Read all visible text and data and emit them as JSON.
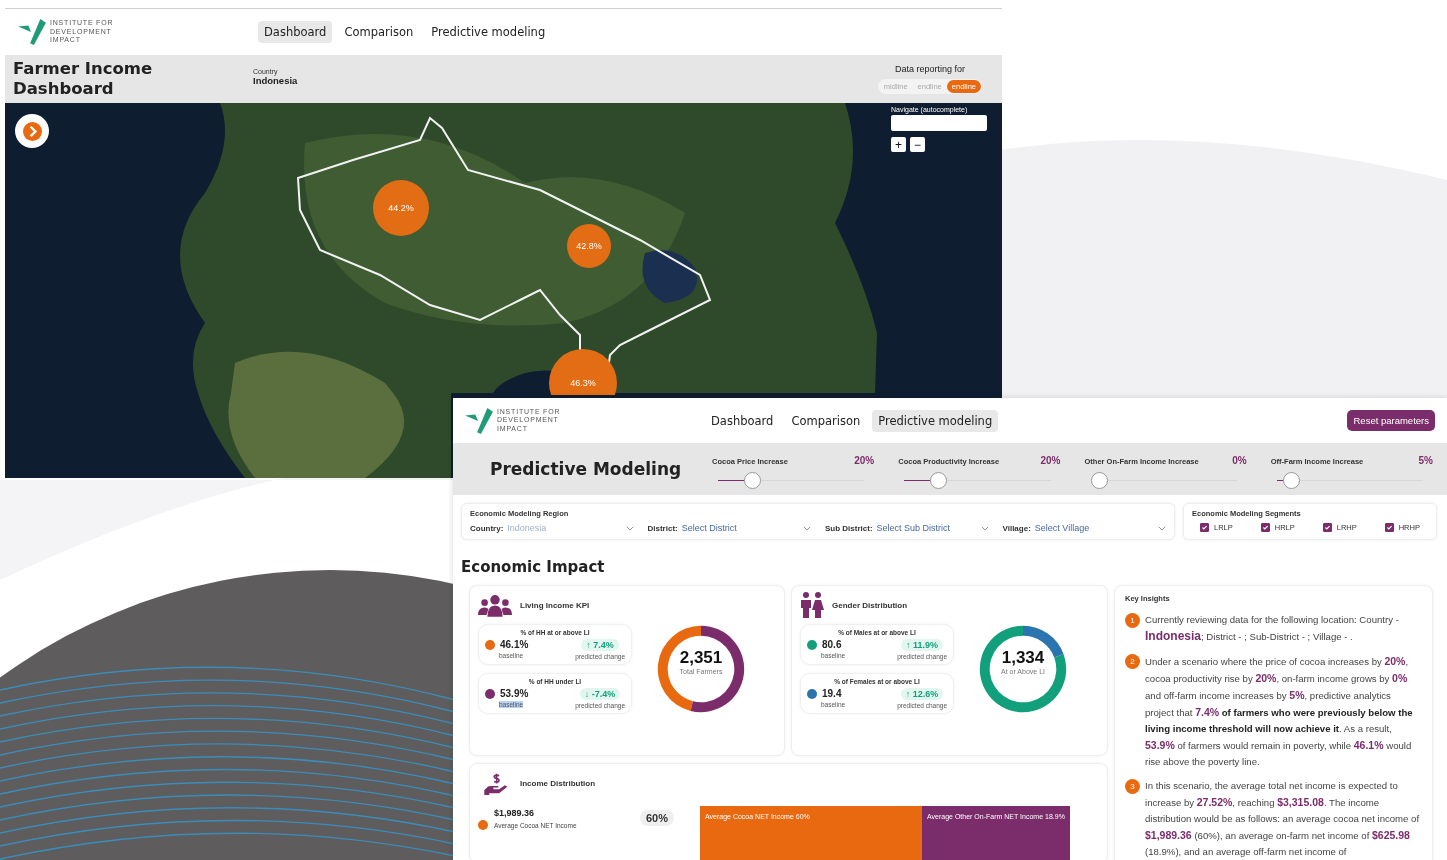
{
  "dashboard_window": {
    "brand": {
      "lines": [
        "INSTITUTE FOR",
        "DEVELOPMENT",
        "IMPACT"
      ]
    },
    "nav": [
      {
        "label": "Dashboard",
        "selected": true
      },
      {
        "label": "Comparison",
        "selected": false
      },
      {
        "label": "Predictive modeling",
        "selected": false
      }
    ],
    "title": "Farmer Income Dashboard",
    "country": {
      "label": "Country",
      "value": "Indonesia"
    },
    "reporting": {
      "label": "Data reporting for",
      "options": [
        {
          "label": "midline",
          "selected": false
        },
        {
          "label": "endline",
          "selected": false
        },
        {
          "label": "endline",
          "selected": true
        }
      ]
    },
    "navigate": {
      "label": "Navigate (autocomplete)"
    },
    "zoom_controls": [
      "+",
      "−"
    ],
    "map_markers": [
      {
        "label": "44.2%"
      },
      {
        "label": "42.8%"
      },
      {
        "label": "46.3%"
      }
    ]
  },
  "modeling_window": {
    "brand": {
      "lines": [
        "INSTITUTE FOR",
        "DEVELOPMENT",
        "IMPACT"
      ]
    },
    "nav": [
      {
        "label": "Dashboard",
        "selected": false
      },
      {
        "label": "Comparison",
        "selected": false
      },
      {
        "label": "Predictive modeling",
        "selected": true
      }
    ],
    "reset_button": "Reset parameters",
    "title": "Predictive Modeling",
    "sliders": [
      {
        "label": "Cocoa Price Increase",
        "reading": "20%",
        "level": 0.2
      },
      {
        "label": "Cocoa Productivity Increase",
        "reading": "20%",
        "level": 0.2
      },
      {
        "label": "Other On-Farm Income Increase",
        "reading": "0%",
        "level": 0
      },
      {
        "label": "Off-Farm Income Increase",
        "reading": "5%",
        "level": 0.05
      }
    ],
    "region": {
      "title": "Economic Modeling Region",
      "filters": [
        {
          "label": "Country:",
          "value": "Indonesia",
          "disabled": true
        },
        {
          "label": "District:",
          "value": "Select District",
          "disabled": false
        },
        {
          "label": "Sub District:",
          "value": "Select Sub District",
          "disabled": false
        },
        {
          "label": "Village:",
          "value": "Select Village",
          "disabled": false
        }
      ]
    },
    "segments": {
      "title": "Economic Modeling Segments",
      "items": [
        {
          "label": "LRLP",
          "checked": true
        },
        {
          "label": "HRLP",
          "checked": true
        },
        {
          "label": "LRHP",
          "checked": true
        },
        {
          "label": "HRHP",
          "checked": true
        }
      ]
    },
    "section_title": "Economic Impact",
    "living_income": {
      "title": "Living Income KPI",
      "metrics": [
        {
          "heading": "% of HH at or above LI",
          "value": "46.1%",
          "color": "#e8690f",
          "caption": "baseline",
          "highlighted": false,
          "change": "↑ 7.4%",
          "change_caption": "predicted change"
        },
        {
          "heading": "% of HH under LI",
          "value": "53.9%",
          "color": "#7b2d6b",
          "caption": "baseline",
          "highlighted": true,
          "change": "↓ -7.4%",
          "change_caption": "predicted change"
        }
      ],
      "total": "2,351",
      "total_caption": "Total Farmers",
      "chart_data": {
        "type": "donut",
        "values": [
          46.1,
          53.9
        ]
      }
    },
    "gender": {
      "title": "Gender Distribution",
      "metrics": [
        {
          "heading": "% of Males at or above LI",
          "value": "80.6",
          "color": "#12a07c",
          "caption": "baseline",
          "highlighted": false,
          "change": "↑ 11.9%",
          "change_caption": "predicted change"
        },
        {
          "heading": "% of Females at or above LI",
          "value": "19.4",
          "color": "#2a74b0",
          "caption": "baseline",
          "highlighted": false,
          "change": "↑ 12.6%",
          "change_caption": "predicted change"
        }
      ],
      "total": "1,334",
      "total_caption": "At or Above LI",
      "chart_data": {
        "type": "donut",
        "values": [
          80.6,
          19.4
        ]
      }
    },
    "income_distribution": {
      "title": "Income Distribution",
      "rows": [
        {
          "value": "$1,989.36",
          "caption": "Average Cocoa NET Income",
          "share": "60%",
          "color": "#e8690f"
        }
      ],
      "bar_segments": [
        {
          "label": "Average Cocoa NET Income 60%",
          "color": "#e8690f"
        },
        {
          "label": "Average Other On-Farm NET Income 18.9%",
          "color": "#7b2d6b"
        }
      ]
    },
    "key_insights": {
      "title": "Key Insights",
      "items": [
        {
          "number": "1",
          "runs": [
            {
              "kind": "plain",
              "text": "Currently reviewing data for the following location: Country - "
            },
            {
              "kind": "big",
              "text": "Indonesia"
            },
            {
              "kind": "plain",
              "text": "; District - ; Sub-District - ; Village - ."
            }
          ]
        },
        {
          "number": "2",
          "runs": [
            {
              "kind": "plain",
              "text": "Under a scenario where the price of cocoa increases by "
            },
            {
              "kind": "highlight",
              "text": "20%"
            },
            {
              "kind": "plain",
              "text": ", cocoa productivity rise by "
            },
            {
              "kind": "highlight",
              "text": "20%"
            },
            {
              "kind": "plain",
              "text": ", on-farm income grows by "
            },
            {
              "kind": "highlight",
              "text": "0%"
            },
            {
              "kind": "plain",
              "text": " and off-farm income increases by "
            },
            {
              "kind": "highlight",
              "text": "5%"
            },
            {
              "kind": "plain",
              "text": ", predictive analytics project that "
            },
            {
              "kind": "highlight",
              "text": "7.4%"
            },
            {
              "kind": "bold",
              "text": " of farmers who were previously below the living income threshold will now achieve it"
            },
            {
              "kind": "plain",
              "text": ". As a result, "
            },
            {
              "kind": "highlight",
              "text": "53.9%"
            },
            {
              "kind": "plain",
              "text": " of farmers would remain in poverty, while "
            },
            {
              "kind": "highlight",
              "text": "46.1%"
            },
            {
              "kind": "plain",
              "text": " would rise above the poverty line."
            }
          ]
        },
        {
          "number": "3",
          "runs": [
            {
              "kind": "plain",
              "text": "In this scenario, the average total net income is expected to increase by "
            },
            {
              "kind": "highlight",
              "text": "27.52%"
            },
            {
              "kind": "plain",
              "text": ", reaching "
            },
            {
              "kind": "highlight",
              "text": "$3,315.08"
            },
            {
              "kind": "plain",
              "text": ". The income distribution would be as follows: an average cocoa net income of "
            },
            {
              "kind": "highlight",
              "text": "$1,989.36"
            },
            {
              "kind": "plain",
              "text": " (60%), an average on-farm net income of "
            },
            {
              "kind": "highlight",
              "text": "$625.98"
            },
            {
              "kind": "plain",
              "text": " (18.9%), and an average off-farm net income of"
            }
          ]
        }
      ]
    }
  }
}
